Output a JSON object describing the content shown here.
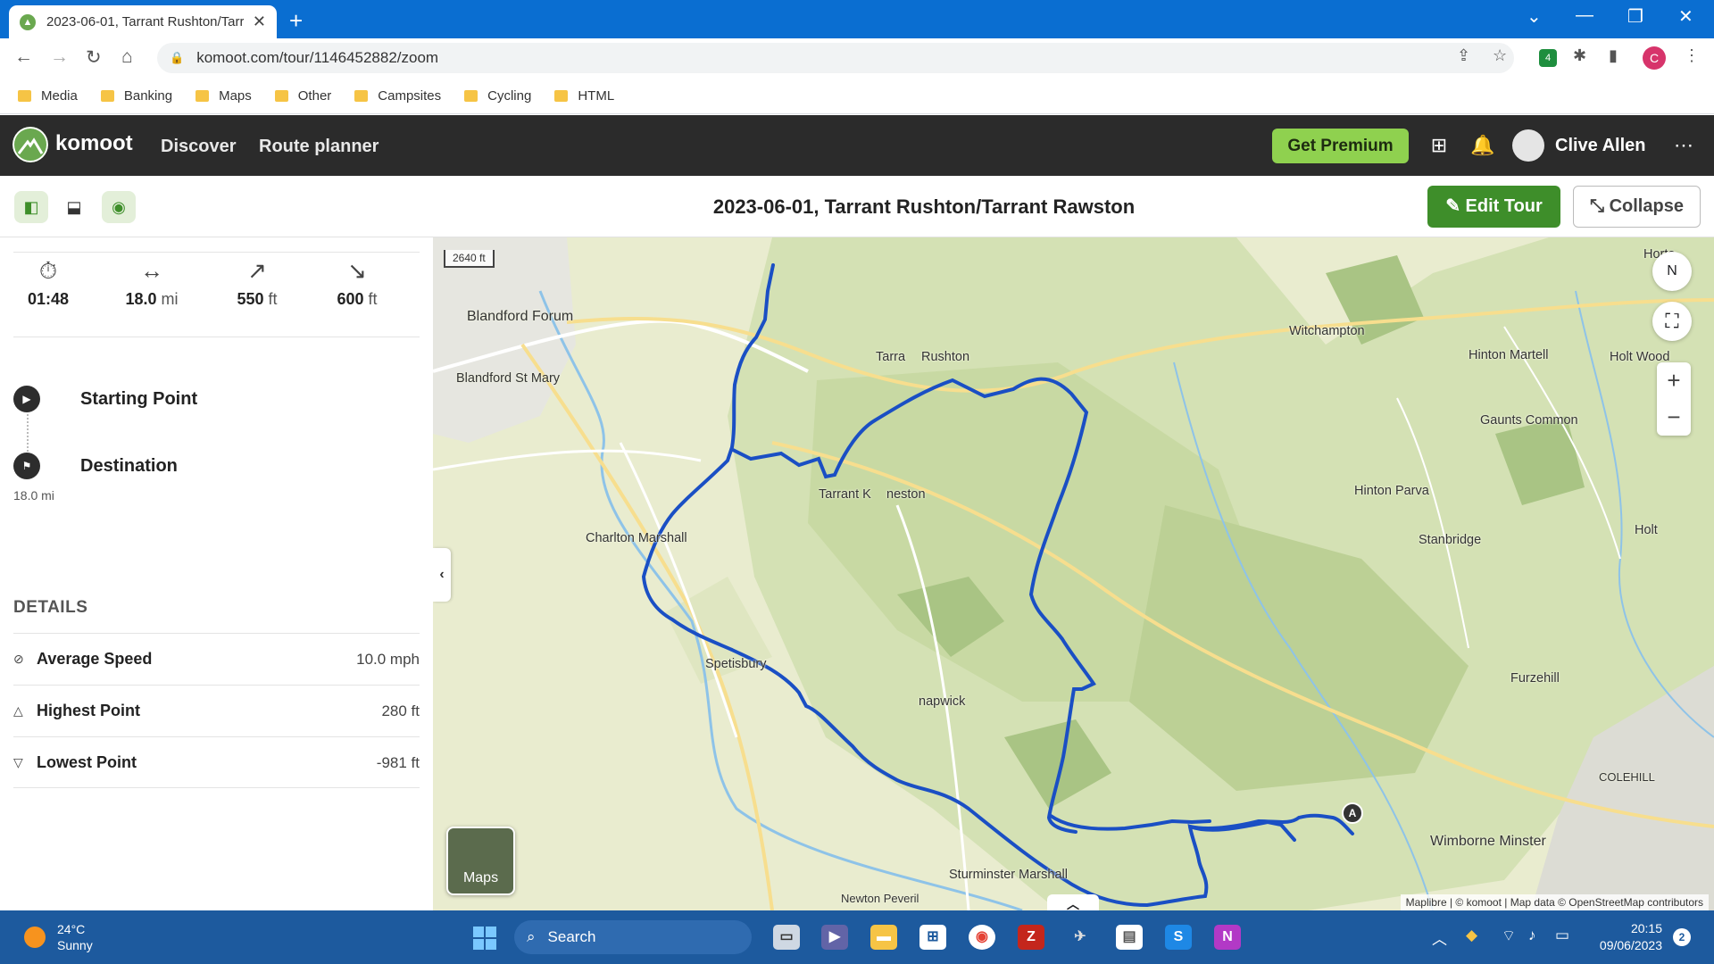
{
  "browser": {
    "tab_title": "2023-06-01, Tarrant Rushton/Tarr",
    "url": "komoot.com/tour/1146452882/zoom",
    "bookmarks": [
      "Media",
      "Banking",
      "Maps",
      "Other",
      "Campsites",
      "Cycling",
      "HTML"
    ],
    "extension_badge": "4",
    "profile_letter": "C"
  },
  "header": {
    "logo": "komoot",
    "nav": [
      "Discover",
      "Route planner"
    ],
    "premium_label": "Get Premium",
    "user_name": "Clive Allen"
  },
  "tour": {
    "title": "2023-06-01, Tarrant Rushton/Tarrant Rawston",
    "edit_label": "Edit Tour",
    "collapse_label": "Collapse"
  },
  "stats": {
    "duration": "01:48",
    "distance": "18.0",
    "distance_unit": "mi",
    "uphill": "550",
    "uphill_unit": "ft",
    "downhill": "600",
    "downhill_unit": "ft"
  },
  "waypoints": {
    "start": "Starting Point",
    "destination": "Destination",
    "distance": "18.0 mi"
  },
  "details": {
    "heading": "DETAILS",
    "rows": [
      {
        "label": "Average Speed",
        "value": "10.0 mph"
      },
      {
        "label": "Highest Point",
        "value": "280 ft"
      },
      {
        "label": "Lowest Point",
        "value": "-981 ft"
      }
    ]
  },
  "map": {
    "scale": "2640 ft",
    "compass": "N",
    "maps_button": "Maps",
    "marker": "A",
    "attribution": "Maplibre | © komoot | Map data © OpenStreetMap contributors",
    "places": [
      "Blandford Forum",
      "Blandford St Mary",
      "Tarra",
      "Rushton",
      "Tarrant K",
      "neston",
      "Charlton Marshall",
      "Spetisbury",
      "napwick",
      "Witchampton",
      "Hinton Martell",
      "Holt Wood",
      "Horto",
      "Gaunts Common",
      "Hinton Parva",
      "Stanbridge",
      "Holt",
      "Furzehill",
      "COLEHILL",
      "Wimborne Minster",
      "Sturminster Marshall",
      "Newton Peveril"
    ],
    "route_color": "#1a4fc4"
  },
  "taskbar": {
    "temp": "24°C",
    "condition": "Sunny",
    "search": "Search",
    "time": "20:15",
    "date": "09/06/2023",
    "notifications": "2"
  }
}
